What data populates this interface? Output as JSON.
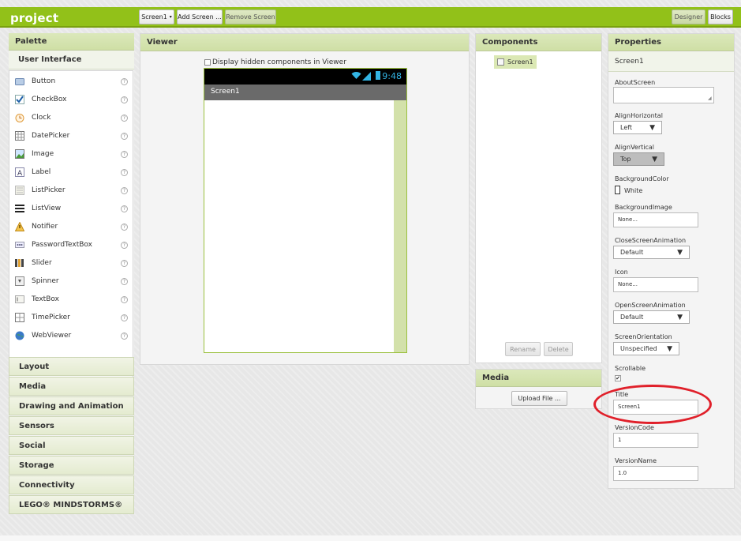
{
  "topbar": {
    "project_name": "project",
    "screen_selector": "Screen1",
    "add_screen": "Add Screen ...",
    "remove_screen": "Remove Screen",
    "designer": "Designer",
    "blocks": "Blocks"
  },
  "palette": {
    "title": "Palette",
    "section": "User Interface",
    "items": [
      {
        "label": "Button",
        "icon": "button-icon"
      },
      {
        "label": "CheckBox",
        "icon": "checkbox-icon"
      },
      {
        "label": "Clock",
        "icon": "clock-icon"
      },
      {
        "label": "DatePicker",
        "icon": "datepicker-icon"
      },
      {
        "label": "Image",
        "icon": "image-icon"
      },
      {
        "label": "Label",
        "icon": "label-icon"
      },
      {
        "label": "ListPicker",
        "icon": "listpicker-icon"
      },
      {
        "label": "ListView",
        "icon": "listview-icon"
      },
      {
        "label": "Notifier",
        "icon": "notifier-icon"
      },
      {
        "label": "PasswordTextBox",
        "icon": "passwordtextbox-icon"
      },
      {
        "label": "Slider",
        "icon": "slider-icon"
      },
      {
        "label": "Spinner",
        "icon": "spinner-icon"
      },
      {
        "label": "TextBox",
        "icon": "textbox-icon"
      },
      {
        "label": "TimePicker",
        "icon": "timepicker-icon"
      },
      {
        "label": "WebViewer",
        "icon": "webviewer-icon"
      }
    ],
    "help_glyph": "?",
    "categories": [
      "Layout",
      "Media",
      "Drawing and Animation",
      "Sensors",
      "Social",
      "Storage",
      "Connectivity",
      "LEGO® MINDSTORMS®"
    ]
  },
  "viewer": {
    "title": "Viewer",
    "hidden_toggle": "Display hidden components in Viewer",
    "phone": {
      "time": "9:48",
      "screen_title": "Screen1"
    }
  },
  "components": {
    "title": "Components",
    "root": "Screen1",
    "rename": "Rename",
    "delete": "Delete"
  },
  "media": {
    "title": "Media",
    "upload": "Upload File ..."
  },
  "properties": {
    "title": "Properties",
    "component": "Screen1",
    "about_screen": {
      "label": "AboutScreen",
      "value": ""
    },
    "align_horizontal": {
      "label": "AlignHorizontal",
      "value": "Left"
    },
    "align_vertical": {
      "label": "AlignVertical",
      "value": "Top"
    },
    "background_color": {
      "label": "BackgroundColor",
      "value": "White"
    },
    "background_image": {
      "label": "BackgroundImage",
      "value": "None..."
    },
    "close_animation": {
      "label": "CloseScreenAnimation",
      "value": "Default"
    },
    "icon": {
      "label": "Icon",
      "value": "None..."
    },
    "open_animation": {
      "label": "OpenScreenAnimation",
      "value": "Default"
    },
    "orientation": {
      "label": "ScreenOrientation",
      "value": "Unspecified"
    },
    "scrollable": {
      "label": "Scrollable",
      "checked": true
    },
    "title_prop": {
      "label": "Title",
      "value": "Screen1"
    },
    "version_code": {
      "label": "VersionCode",
      "value": "1"
    },
    "version_name": {
      "label": "VersionName",
      "value": "1.0"
    }
  },
  "colors": {
    "accent_green": "#92c119",
    "highlight_red": "#e0202a",
    "android_blue": "#33b5e5"
  }
}
